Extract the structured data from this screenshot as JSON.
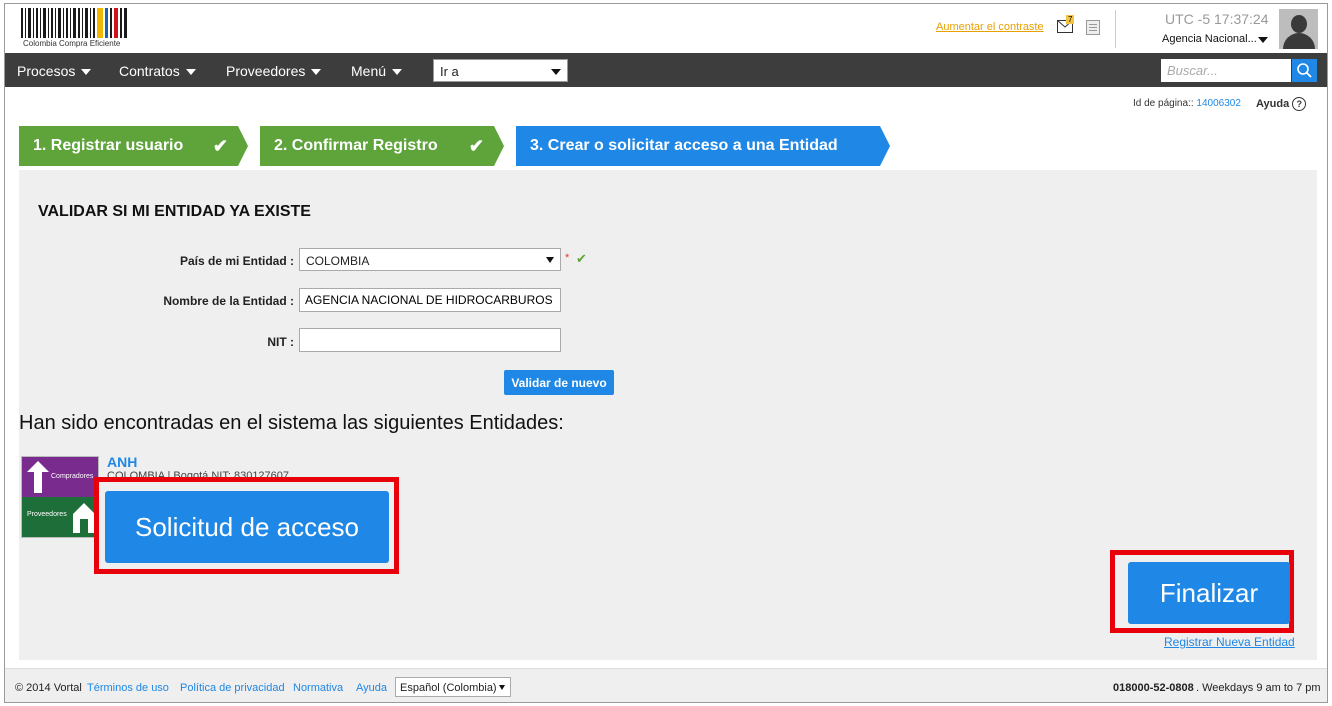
{
  "header": {
    "logo_text": "Colombia Compra Eficiente",
    "contrast_link": "Aumentar el contraste",
    "mail_badge": "7",
    "clock": "UTC -5 17:37:24",
    "agency": "Agencia Nacional..."
  },
  "nav": {
    "items": [
      {
        "label": "Procesos"
      },
      {
        "label": "Contratos"
      },
      {
        "label": "Proveedores"
      },
      {
        "label": "Menú"
      }
    ],
    "goto_value": "Ir a",
    "search_placeholder": "Buscar..."
  },
  "page": {
    "id_label": "Id de página::",
    "id_value": "14006302",
    "help": "Ayuda",
    "help_icon": "?"
  },
  "steps": [
    {
      "label": "1. Registrar usuario",
      "status": "done"
    },
    {
      "label": "2. Confirmar Registro",
      "status": "done"
    },
    {
      "label": "3. Crear o solicitar acceso a una Entidad",
      "status": "active"
    }
  ],
  "form": {
    "title": "VALIDAR SI MI ENTIDAD YA EXISTE",
    "country_label": "País de mi Entidad :",
    "country_value": "COLOMBIA",
    "required_mark": "*",
    "name_label": "Nombre de la Entidad :",
    "name_value": "AGENCIA NACIONAL DE HIDROCARBUROS",
    "nit_label": "NIT :",
    "nit_value": "",
    "validate_button": "Validar de nuevo"
  },
  "results": {
    "heading": "Han sido encontradas en el sistema las siguientes Entidades:",
    "entities": [
      {
        "name": "ANH",
        "meta": "COLOMBIA | Bogotá  NIT: 830127607",
        "logo_top": "Compradores",
        "logo_bottom": "Proveedores"
      }
    ],
    "access_button": "Solicitud de acceso",
    "finish_button": "Finalizar",
    "register_link": "Registrar Nueva Entidad"
  },
  "footer": {
    "copyright": "© 2014 Vortal",
    "links": [
      "Términos de uso",
      "Política de privacidad",
      "Normativa",
      "Ayuda"
    ],
    "language": "Español (Colombia)",
    "phone": "018000-52-0808",
    "hours": ". Weekdays 9 am to 7 pm"
  },
  "colors": {
    "accent": "#1f87e5",
    "step_done": "#5ea43a",
    "highlight": "#e8000b",
    "nav_bg": "#3d3d3d"
  }
}
